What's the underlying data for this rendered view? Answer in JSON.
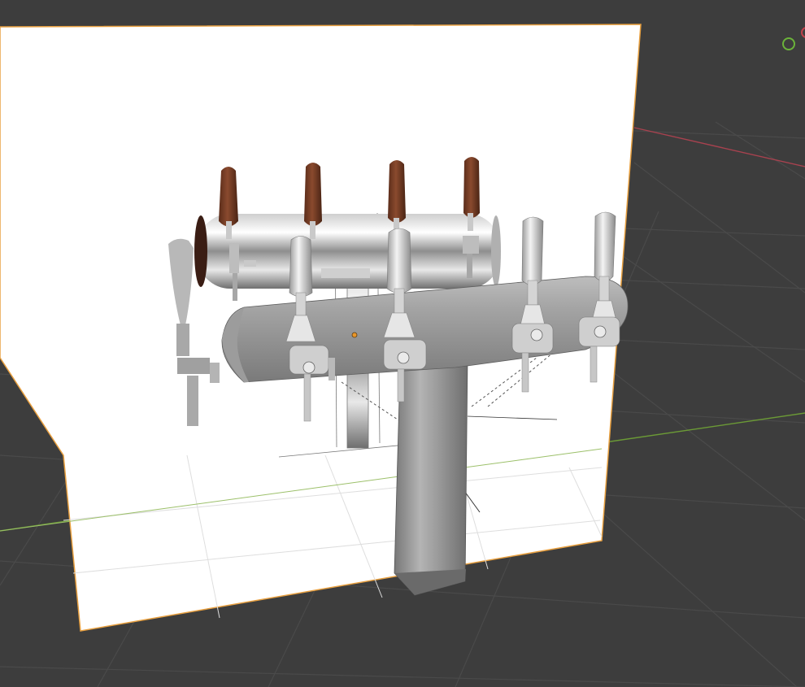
{
  "viewport": {
    "background": "#3d3d3d",
    "grid_color": "#4a4a4a",
    "axis_x_color": "#a8424f",
    "axis_y_color": "#6b9a36",
    "reference_image_border": "#e8a040",
    "origin_color": "#e8962a",
    "gizmo_y_color": "#6bb33a"
  },
  "objects": {
    "reference_plane": "reference-image-plane",
    "tower": "beer-tap-tower-model",
    "taps_count": 4
  }
}
